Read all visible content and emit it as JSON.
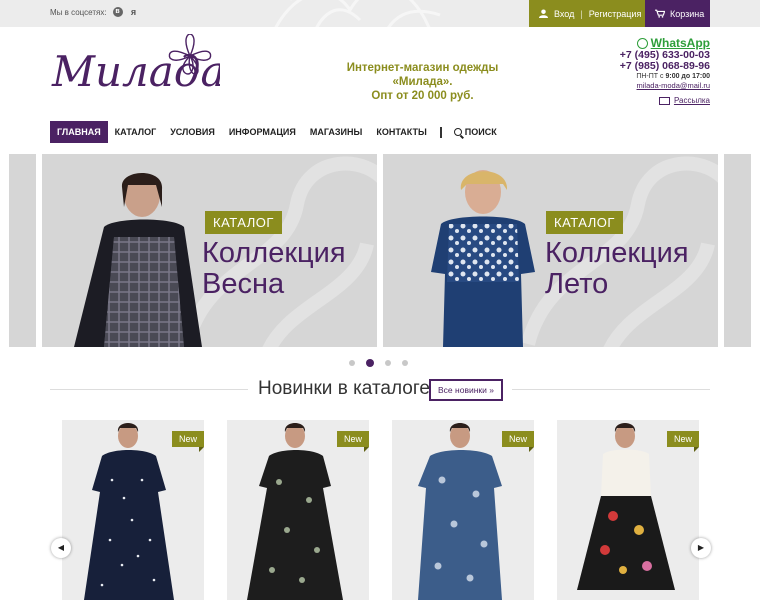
{
  "topbar": {
    "social_label": "Мы в соцсетях:",
    "social_icons": [
      "vk-icon",
      "yandex-icon"
    ],
    "login_label": "Вход",
    "register_label": "Регистрация",
    "cart_label": "Корзина"
  },
  "header": {
    "logo_text": "Милада",
    "slogan_line1": "Интернет-магазин одежды «Милада».",
    "slogan_line2": "Опт от 20 000 руб.",
    "whatsapp_label": "WhatsApp",
    "phone1": "+7 (495) 633-00-03",
    "phone2": "+7 (985) 068-89-96",
    "hours_prefix": "ПН-ПТ с ",
    "hours_value": "9:00 до 17:00",
    "email": "milada-moda@mail.ru",
    "newsletter_label": "Рассылка"
  },
  "nav": {
    "items": [
      "Главная",
      "Каталог",
      "Условия",
      "Информация",
      "Магазины",
      "Контакты"
    ],
    "active_index": 0,
    "search_label": "Поиск"
  },
  "slider": {
    "slides": [
      {
        "tag": "КАТАЛОГ",
        "title_line1": "Коллекция",
        "title_line2": "Весна"
      },
      {
        "tag": "КАТАЛОГ",
        "title_line1": "Коллекция",
        "title_line2": "Лето"
      }
    ],
    "dots_count": 4,
    "active_dot": 1
  },
  "novelties": {
    "title": "Новинки в каталоге",
    "all_button": "Все новинки »",
    "badge": "New",
    "cards": 4
  },
  "colors": {
    "brand_purple": "#4b2263",
    "brand_olive": "#8b8d1e",
    "whatsapp_green": "#2e9e3a"
  }
}
